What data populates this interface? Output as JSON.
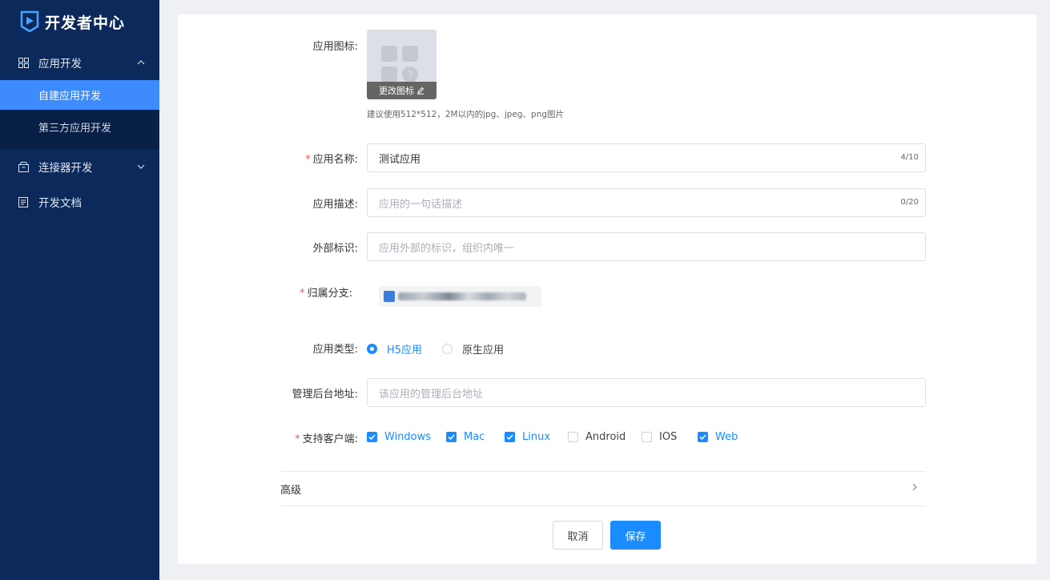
{
  "app": {
    "title": "开发者中心"
  },
  "sidebar": {
    "app_dev": {
      "label": "应用开发",
      "sub_items": [
        "自建应用开发",
        "第三方应用开发"
      ],
      "active_sub": "自建应用开发"
    },
    "connector_dev": {
      "label": "连接器开发"
    },
    "docs": {
      "label": "开发文档"
    }
  },
  "form": {
    "icon": {
      "label": "应用图标",
      "change_label": "更改图标",
      "hint": "建议使用512*512，2M以内的jpg、jpeg、png图片"
    },
    "name": {
      "label": "应用名称",
      "required": true,
      "value": "测试应用",
      "counter": "4/10"
    },
    "description": {
      "label": "应用描述",
      "placeholder": "应用的一句话描述",
      "counter": "0/20"
    },
    "external_id": {
      "label": "外部标识",
      "placeholder": "应用外部的标识，组织内唯一"
    },
    "branch": {
      "label": "归属分支:",
      "required": true
    },
    "app_type": {
      "label": "应用类型",
      "options": [
        "H5应用",
        "原生应用"
      ],
      "selected": "H5应用"
    },
    "admin_url": {
      "label": "管理后台地址",
      "placeholder": "该应用的管理后台地址"
    },
    "clients": {
      "label": "支持客户端",
      "required": true,
      "options": [
        {
          "name": "Windows",
          "checked": true
        },
        {
          "name": "Mac",
          "checked": true
        },
        {
          "name": "Linux",
          "checked": true
        },
        {
          "name": "Android",
          "checked": false
        },
        {
          "name": "IOS",
          "checked": false
        },
        {
          "name": "Web",
          "checked": true
        }
      ]
    },
    "advanced": {
      "label": "高级"
    }
  },
  "actions": {
    "cancel": "取消",
    "save": "保存"
  },
  "colors": {
    "sidebar_bg": "#0b2a5b",
    "accent": "#1a8cff",
    "active_menu": "#3d8bfd",
    "required": "#f25a4a"
  }
}
